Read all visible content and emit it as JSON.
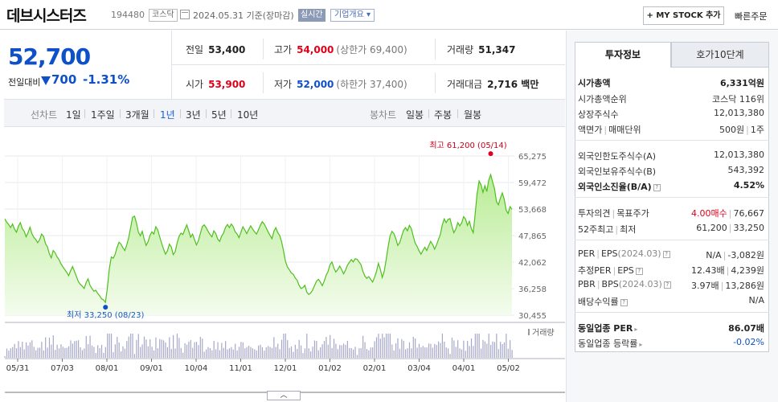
{
  "header": {
    "name": "데브시스터즈",
    "code": "194480",
    "market": "코스닥",
    "date": "2024.05.31 기준(장마감)",
    "realtime": "실시간",
    "company_overview": "기업개요 ▾",
    "my_stock": "+ MY STOCK 추가",
    "quick_order": "빠른주문"
  },
  "price": {
    "current": "52,700",
    "change_label": "전일대비",
    "change": "700",
    "change_pct": "-1.31%"
  },
  "quote": {
    "prev_close": {
      "label": "전일",
      "value": "53,400"
    },
    "high": {
      "label": "고가",
      "value": "54,000",
      "sub": "(상한가 69,400)"
    },
    "volume": {
      "label": "거래량",
      "value": "51,347"
    },
    "open": {
      "label": "시가",
      "value": "53,900"
    },
    "low": {
      "label": "저가",
      "value": "52,000",
      "sub": "(하한가 37,400)"
    },
    "amount": {
      "label": "거래대금",
      "value": "2,716 백만"
    }
  },
  "chart_tabs": {
    "line_label": "선차트",
    "periods": [
      "1일",
      "1주일",
      "3개월",
      "1년",
      "3년",
      "5년",
      "10년"
    ],
    "selected_period": "1년",
    "candle_label": "봉차트",
    "candles": [
      "일봉",
      "주봉",
      "월봉"
    ]
  },
  "chart_data": {
    "type": "area",
    "title": "",
    "x_tick_labels": [
      "05/31",
      "07/03",
      "08/01",
      "09/01",
      "10/04",
      "11/01",
      "12/01",
      "01/02",
      "02/01",
      "03/04",
      "04/01",
      "05/02"
    ],
    "y_ticks": [
      "65,275",
      "59,472",
      "53,668",
      "47,865",
      "42,062",
      "36,258",
      "30,455"
    ],
    "ylim": [
      30455,
      65275
    ],
    "high_annotation": "최고 61,200 (05/14)",
    "low_annotation": "최저 33,250 (08/23)",
    "volume_legend": "거래량",
    "prices": [
      51500,
      50800,
      50300,
      49600,
      50400,
      49300,
      48600,
      49900,
      50700,
      49400,
      48800,
      47600,
      48500,
      49700,
      48300,
      47500,
      47000,
      46300,
      47000,
      48200,
      47700,
      46100,
      45400,
      43900,
      43000,
      44600,
      44100,
      43200,
      42600,
      41700,
      41000,
      40400,
      39800,
      39100,
      40200,
      41100,
      40000,
      38900,
      37800,
      37200,
      36800,
      36300,
      37600,
      38400,
      37000,
      36300,
      35700,
      35900,
      35200,
      34700,
      34000,
      33800,
      33250,
      36400,
      40700,
      43200,
      42900,
      43800,
      45300,
      46400,
      46000,
      45200,
      44600,
      45800,
      47400,
      49600,
      51900,
      52100,
      50600,
      48600,
      47800,
      48800,
      47100,
      45700,
      46500,
      47900,
      48700,
      48200,
      49800,
      49100,
      47600,
      46200,
      44900,
      43800,
      44500,
      46000,
      45400,
      43700,
      44300,
      46200,
      47700,
      48400,
      48100,
      49200,
      50200,
      48900,
      47500,
      48200,
      47000,
      45800,
      46700,
      48300,
      49800,
      50200,
      49600,
      48800,
      48100,
      47600,
      48900,
      48300,
      47100,
      46600,
      47700,
      48400,
      49700,
      50300,
      49600,
      50400,
      49800,
      48700,
      48200,
      47400,
      48600,
      49800,
      49100,
      48300,
      49200,
      50000,
      49300,
      48700,
      48200,
      49100,
      50100,
      50900,
      50400,
      49600,
      48700,
      47900,
      47200,
      48800,
      49600,
      48500,
      47900,
      46500,
      44500,
      42200,
      41000,
      40400,
      39700,
      39400,
      38600,
      38100,
      37000,
      36300,
      36500,
      37000,
      35500,
      35000,
      35300,
      35900,
      36900,
      37900,
      38300,
      37700,
      36900,
      37900,
      39200,
      40000,
      41500,
      42100,
      40800,
      39900,
      40400,
      41200,
      40400,
      39500,
      40300,
      41400,
      42000,
      42600,
      42100,
      42800,
      42700,
      42100,
      41500,
      40000,
      39000,
      38500,
      38900,
      38300,
      37700,
      38700,
      40000,
      41800,
      40500,
      38700,
      40000,
      42600,
      45400,
      47800,
      48800,
      48300,
      47200,
      45700,
      46300,
      47700,
      49000,
      49600,
      48900,
      50100,
      49400,
      47700,
      46200,
      45500,
      44500,
      43800,
      44600,
      45300,
      44600,
      45600,
      46600,
      45900,
      44900,
      45800,
      47000,
      48100,
      50200,
      51500,
      50700,
      51400,
      51600,
      49900,
      48500,
      49300,
      50700,
      50000,
      50600,
      52000,
      51500,
      50100,
      51000,
      49400,
      48500,
      52600,
      57000,
      59800,
      59000,
      57300,
      58800,
      57500,
      60000,
      61200,
      59600,
      58100,
      55300,
      54600,
      56000,
      57200,
      55800,
      53400,
      52700,
      54200,
      53600
    ]
  },
  "expand_label": "︿",
  "right_panel": {
    "tab_active": "투자정보",
    "tab_other": "호가10단계",
    "market_cap": {
      "label": "시가총액",
      "value": "6,331억원"
    },
    "market_cap_rank": {
      "label": "시가총액순위",
      "value": "코스닥 116위"
    },
    "shares": {
      "label": "상장주식수",
      "value": "12,013,380"
    },
    "par": {
      "label": "액면가",
      "label2": "매매단위",
      "value": "500원",
      "value2": "1주"
    },
    "foreign_limit": {
      "label": "외국인한도주식수(A)",
      "value": "12,013,380"
    },
    "foreign_hold": {
      "label": "외국인보유주식수(B)",
      "value": "543,392"
    },
    "foreign_rate": {
      "label": "외국인소진율(B/A)",
      "value": "4.52%"
    },
    "opinion": {
      "label": "투자의견",
      "label2": "목표주가",
      "value": "4.00매수",
      "value2": "76,667"
    },
    "week52": {
      "label": "52주최고",
      "label2": "최저",
      "value": "61,200",
      "value2": "33,250"
    },
    "per": {
      "label": "PER",
      "label2": "EPS",
      "period": "(2024.03)",
      "value": "N/A",
      "value2": "-3,082원"
    },
    "est_per": {
      "label": "추정PER",
      "label2": "EPS",
      "value": "12.43배",
      "value2": "4,239원"
    },
    "pbr": {
      "label": "PBR",
      "label2": "BPS",
      "period": "(2024.03)",
      "value": "3.97배",
      "value2": "13,286원"
    },
    "dividend": {
      "label": "배당수익률",
      "value": "N/A"
    },
    "sector_per": {
      "label": "동일업종 PER",
      "value": "86.07배"
    },
    "sector_change": {
      "label": "동일업종 등락률",
      "value": "-0.02%"
    }
  }
}
